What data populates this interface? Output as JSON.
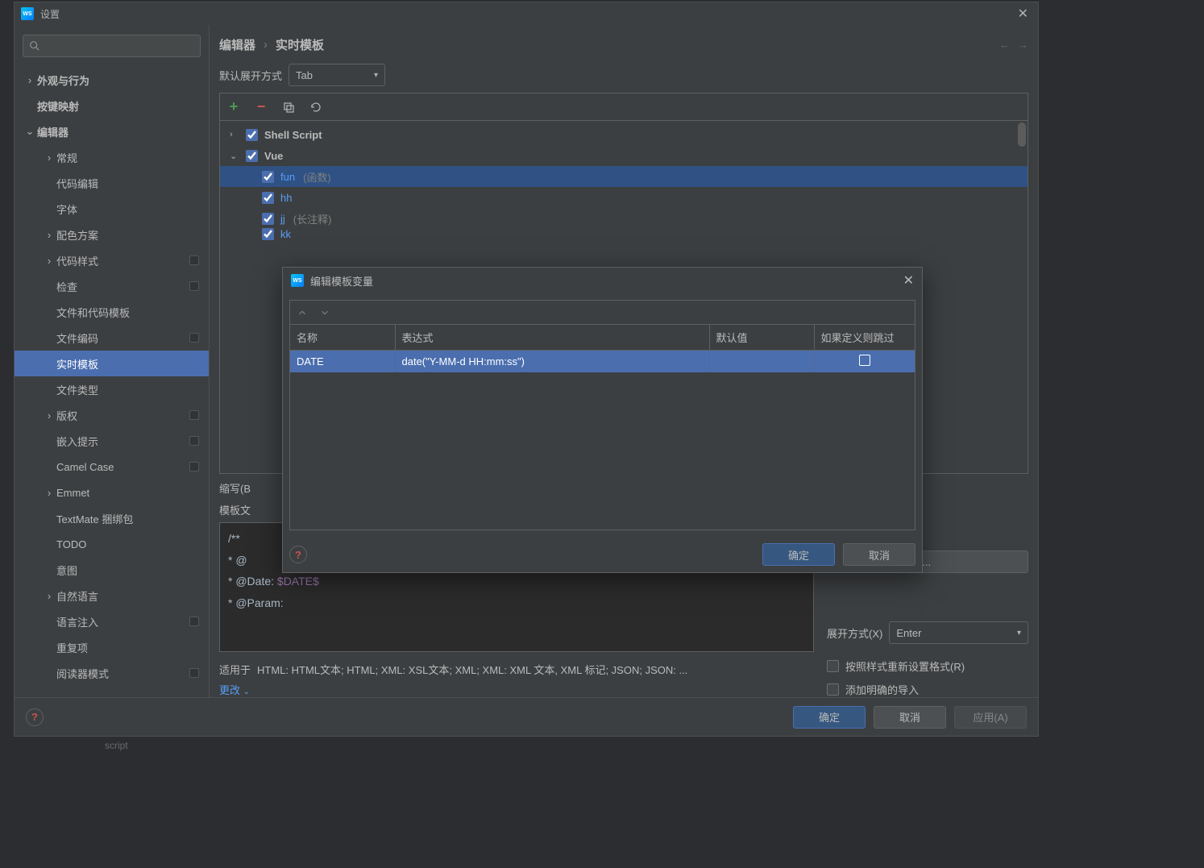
{
  "window": {
    "title": "设置"
  },
  "breadcrumb": {
    "item1": "编辑器",
    "item2": "实时模板"
  },
  "nav": {
    "back": "←",
    "forward": "→"
  },
  "expand": {
    "label": "默认展开方式",
    "value": "Tab"
  },
  "sidebar": {
    "items": [
      {
        "label": "外观与行为",
        "depth": 0,
        "bold": true,
        "arrow": "›"
      },
      {
        "label": "按键映射",
        "depth": 0,
        "bold": true
      },
      {
        "label": "编辑器",
        "depth": 0,
        "bold": true,
        "arrow": "⌄"
      },
      {
        "label": "常规",
        "depth": 1,
        "arrow": "›"
      },
      {
        "label": "代码编辑",
        "depth": 1
      },
      {
        "label": "字体",
        "depth": 1
      },
      {
        "label": "配色方案",
        "depth": 1,
        "arrow": "›"
      },
      {
        "label": "代码样式",
        "depth": 1,
        "arrow": "›",
        "badge": true
      },
      {
        "label": "检查",
        "depth": 1,
        "badge": true
      },
      {
        "label": "文件和代码模板",
        "depth": 1
      },
      {
        "label": "文件编码",
        "depth": 1,
        "badge": true
      },
      {
        "label": "实时模板",
        "depth": 1,
        "selected": true
      },
      {
        "label": "文件类型",
        "depth": 1
      },
      {
        "label": "版权",
        "depth": 1,
        "arrow": "›",
        "badge": true
      },
      {
        "label": "嵌入提示",
        "depth": 1,
        "badge": true
      },
      {
        "label": "Camel Case",
        "depth": 1,
        "badge": true
      },
      {
        "label": "Emmet",
        "depth": 1,
        "arrow": "›"
      },
      {
        "label": "TextMate 捆绑包",
        "depth": 1
      },
      {
        "label": "TODO",
        "depth": 1
      },
      {
        "label": "意图",
        "depth": 1
      },
      {
        "label": "自然语言",
        "depth": 1,
        "arrow": "›"
      },
      {
        "label": "语言注入",
        "depth": 1,
        "badge": true
      },
      {
        "label": "重复项",
        "depth": 1
      },
      {
        "label": "阅读器模式",
        "depth": 1,
        "badge": true
      }
    ]
  },
  "groups": {
    "items": [
      {
        "depth": 0,
        "arrow": "›",
        "checked": true,
        "name": "Shell Script"
      },
      {
        "depth": 0,
        "arrow": "⌄",
        "checked": true,
        "name": "Vue"
      },
      {
        "depth": 1,
        "checked": true,
        "name": "fun",
        "desc": "(函数)",
        "link": true,
        "selected": true
      },
      {
        "depth": 1,
        "checked": true,
        "name": "hh",
        "link": true
      },
      {
        "depth": 1,
        "checked": true,
        "name": "jj",
        "desc": "(长注释)",
        "link": true
      },
      {
        "depth": 1,
        "checked": true,
        "name": "kk",
        "link": true,
        "cutoff": true
      }
    ]
  },
  "abbrev": {
    "label": "缩写(B"
  },
  "template": {
    "label": "模板文",
    "line1_a": "/**",
    "line2_a": " * @",
    "line3_a": " * @Date: ",
    "line3_b": "$DATE$",
    "line4_a": " * @Param:"
  },
  "editvar_btn": "(E)...",
  "expand2": {
    "label": "展开方式(X)",
    "value": "Enter"
  },
  "opt1": "按照样式重新设置格式(R)",
  "opt2": "添加明确的导入",
  "applies": {
    "prefix": "适用于",
    "text": "HTML: HTML文本; HTML; XML: XSL文本; XML; XML: XML 文本, XML 标记; JSON; JSON: ...",
    "change": "更改"
  },
  "footer": {
    "ok": "确定",
    "cancel": "取消",
    "apply": "应用(A)"
  },
  "dialog": {
    "title": "编辑模板变量",
    "headers": {
      "name": "名称",
      "expr": "表达式",
      "def": "默认值",
      "skip": "如果定义则跳过"
    },
    "row": {
      "name": "DATE",
      "expr": "date(\"Y-MM-d HH:mm:ss\")",
      "def": ""
    },
    "ok": "确定",
    "cancel": "取消"
  },
  "script_text": "script"
}
